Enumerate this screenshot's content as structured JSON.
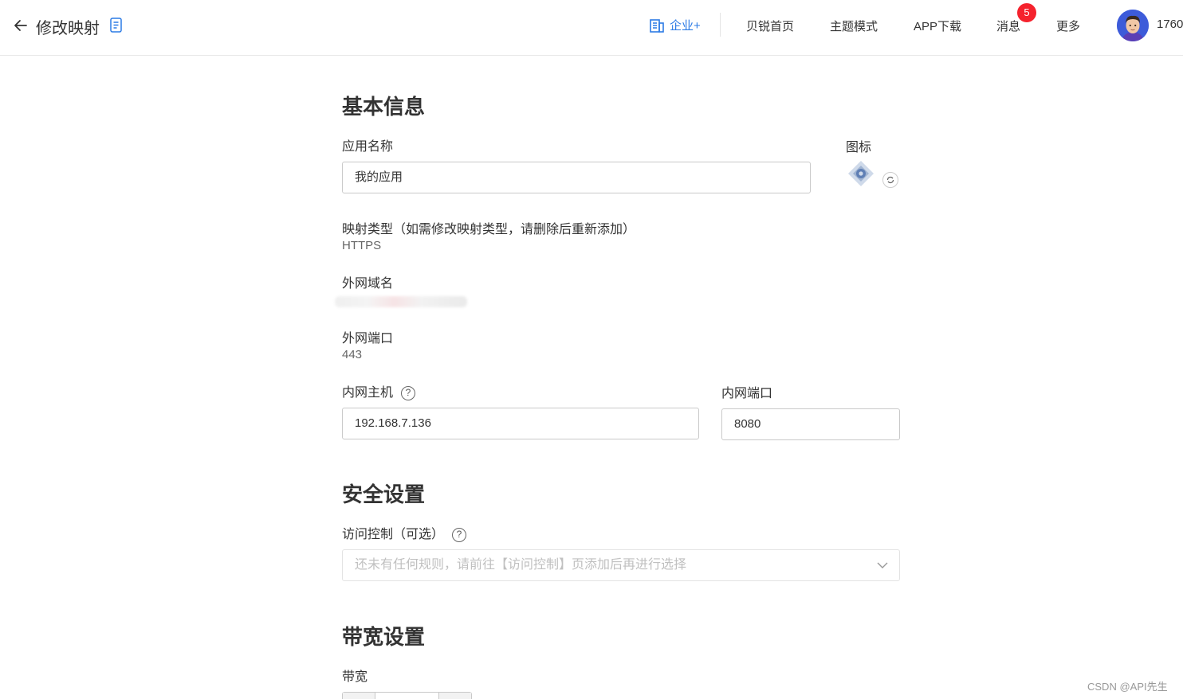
{
  "header": {
    "title": "修改映射",
    "nav": {
      "enterprise": "企业+",
      "home": "贝锐首页",
      "theme": "主题模式",
      "app_download": "APP下载",
      "messages": "消息",
      "messages_badge": "5",
      "more": "更多"
    },
    "user_name": "1760"
  },
  "basic": {
    "section_title": "基本信息",
    "app_name_label": "应用名称",
    "app_name_value": "我的应用",
    "icon_label": "图标",
    "mapping_type_label": "映射类型（如需修改映射类型，请删除后重新添加）",
    "mapping_type_value": "HTTPS",
    "external_domain_label": "外网域名",
    "external_port_label": "外网端口",
    "external_port_value": "443",
    "internal_host_label": "内网主机",
    "internal_host_value": "192.168.7.136",
    "internal_port_label": "内网端口",
    "internal_port_value": "8080"
  },
  "security": {
    "section_title": "安全设置",
    "access_control_label": "访问控制（可选）",
    "access_control_placeholder": "还未有任何规则，请前往【访问控制】页添加后再进行选择"
  },
  "bandwidth": {
    "section_title": "带宽设置",
    "bandwidth_label": "带宽"
  },
  "watermark": "CSDN @API先生",
  "colors": {
    "accent": "#2c7be5",
    "badge": "#f5222d"
  }
}
